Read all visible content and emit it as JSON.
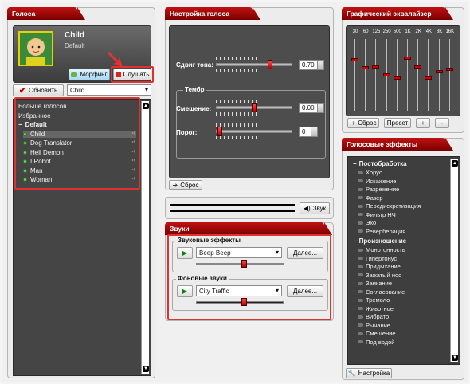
{
  "voices": {
    "title": "Голоса",
    "current_name": "Child",
    "current_group": "Default",
    "morphing_label": "Морфинг",
    "listen_label": "Слушать",
    "refresh_label": "Обновить",
    "selected_voice": "Child",
    "list": [
      {
        "label": "Больше голосов",
        "type": "link"
      },
      {
        "label": "Избранное",
        "type": "link"
      },
      {
        "label": "Default",
        "type": "group"
      },
      {
        "label": "Child",
        "type": "voice",
        "selected": true
      },
      {
        "label": "Dog Translator",
        "type": "voice"
      },
      {
        "label": "Hell Demon",
        "type": "voice"
      },
      {
        "label": "I Robot",
        "type": "voice"
      },
      {
        "label": "Man",
        "type": "voice"
      },
      {
        "label": "Woman",
        "type": "voice"
      }
    ]
  },
  "voice_settings": {
    "title": "Настройка голоса",
    "pitch_label": "Сдвиг тона:",
    "pitch_value": "0.70",
    "pitch_level": 0.72,
    "timbre_group": "Тембр",
    "offset_label": "Смещение:",
    "offset_value": "0.00",
    "offset_level": 0.5,
    "threshold_label": "Порог:",
    "threshold_value": "0",
    "threshold_level": 0.02,
    "reset_label": "Сброс",
    "sound_label": "Звук"
  },
  "equalizer": {
    "title": "Графический эквалайзер",
    "bands": [
      "30",
      "60",
      "125",
      "250",
      "500",
      "1K",
      "2K",
      "4K",
      "8K",
      "16K"
    ],
    "levels": [
      0.72,
      0.6,
      0.62,
      0.5,
      0.45,
      0.75,
      0.62,
      0.45,
      0.55,
      0.58
    ],
    "reset_label": "Сброс",
    "preset_label": "Пресет",
    "plus_label": "+",
    "minus_label": "-"
  },
  "sounds": {
    "title": "Звуки",
    "effects_group": "Звуковые эффекты",
    "effects_selected": "Beep Beep",
    "effects_more": "Далее...",
    "effects_volume": 0.55,
    "bg_group": "Фоновые звуки",
    "bg_selected": "City Traffic",
    "bg_more": "Далее...",
    "bg_volume": 0.55
  },
  "voice_effects": {
    "title": "Голосовые эффекты",
    "settings_label": "Настройка",
    "groups": [
      {
        "name": "Постобработка",
        "items": [
          "Хорус",
          "Искажение",
          "Разрежение",
          "Фазер",
          "Передискретизация",
          "Фильтр НЧ",
          "Эхо",
          "Реверберация"
        ]
      },
      {
        "name": "Произношение",
        "items": [
          "Монотонность",
          "Гипертонус",
          "Придыхание",
          "Зажатый нос",
          "Заикание",
          "Согласование",
          "Тремоло",
          "Животное",
          "Вибрато",
          "Рычание",
          "Смещение",
          "Под водой"
        ]
      }
    ]
  },
  "colors": {
    "accent": "#b00000",
    "highlight_box": "#e03030",
    "dark_panel": "#4d4d4d"
  }
}
